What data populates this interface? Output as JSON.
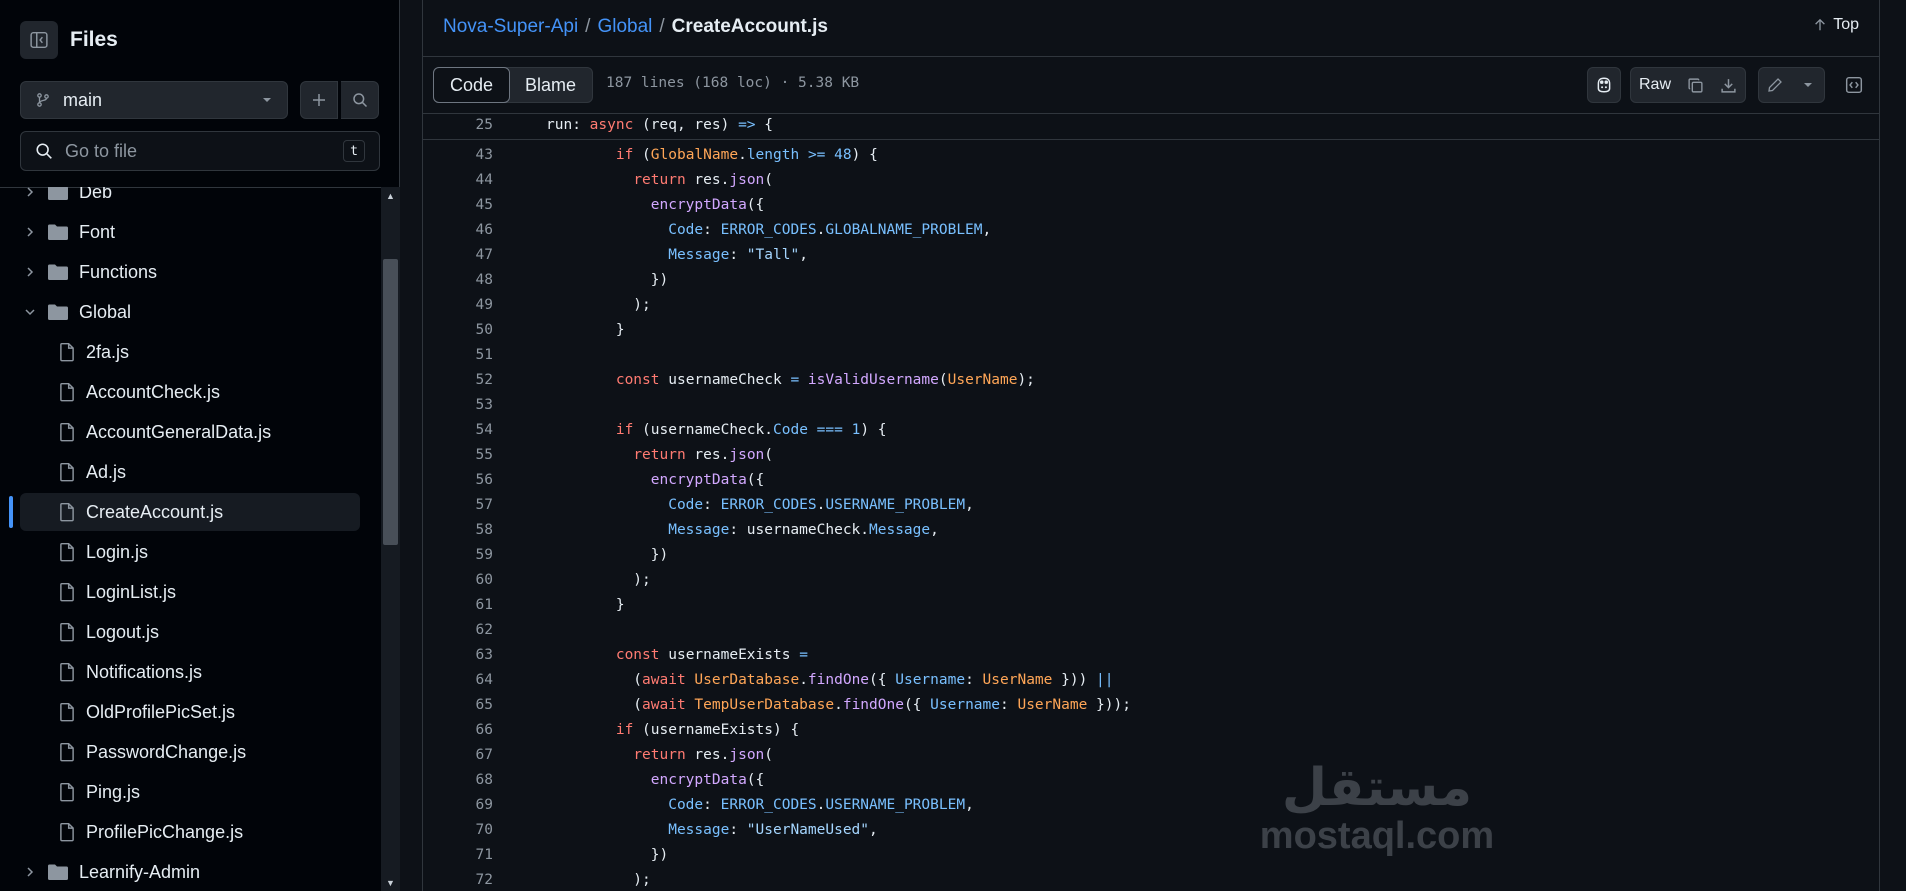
{
  "sidebar": {
    "title": "Files",
    "branch": "main",
    "search_placeholder": "Go to file",
    "search_shortcut": "t",
    "tree": [
      {
        "label": "Deb",
        "type": "folder",
        "expanded": false
      },
      {
        "label": "Font",
        "type": "folder",
        "expanded": false
      },
      {
        "label": "Functions",
        "type": "folder",
        "expanded": false
      },
      {
        "label": "Global",
        "type": "folder",
        "expanded": true
      },
      {
        "label": "2fa.js",
        "type": "file"
      },
      {
        "label": "AccountCheck.js",
        "type": "file"
      },
      {
        "label": "AccountGeneralData.js",
        "type": "file"
      },
      {
        "label": "Ad.js",
        "type": "file"
      },
      {
        "label": "CreateAccount.js",
        "type": "file",
        "selected": true
      },
      {
        "label": "Login.js",
        "type": "file"
      },
      {
        "label": "LoginList.js",
        "type": "file"
      },
      {
        "label": "Logout.js",
        "type": "file"
      },
      {
        "label": "Notifications.js",
        "type": "file"
      },
      {
        "label": "OldProfilePicSet.js",
        "type": "file"
      },
      {
        "label": "PasswordChange.js",
        "type": "file"
      },
      {
        "label": "Ping.js",
        "type": "file"
      },
      {
        "label": "ProfilePicChange.js",
        "type": "file"
      },
      {
        "label": "Learnify-Admin",
        "type": "folder",
        "expanded": false
      }
    ]
  },
  "header": {
    "breadcrumb": {
      "repo": "Nova-Super-Api",
      "folder": "Global",
      "file": "CreateAccount.js"
    },
    "top_label": "Top"
  },
  "toolbar": {
    "code_tab": "Code",
    "blame_tab": "Blame",
    "meta": "187 lines (168 loc) · 5.38 KB",
    "raw_label": "Raw"
  },
  "sticky_line": {
    "num": "25",
    "tokens": [
      [
        "",
        "run: "
      ],
      [
        "kw",
        "async"
      ],
      [
        "",
        " (req, res) "
      ],
      [
        "op",
        "=>"
      ],
      [
        "",
        " {"
      ]
    ]
  },
  "code_lines": [
    {
      "num": "43",
      "tokens": [
        [
          "",
          "        "
        ],
        [
          "kw",
          "if"
        ],
        [
          "",
          " ("
        ],
        [
          "va",
          "GlobalName"
        ],
        [
          "",
          "."
        ],
        [
          "pr",
          "length"
        ],
        [
          "",
          " "
        ],
        [
          "op",
          ">="
        ],
        [
          "",
          " "
        ],
        [
          "pr",
          "48"
        ],
        [
          "",
          ") {"
        ]
      ]
    },
    {
      "num": "44",
      "tokens": [
        [
          "",
          "          "
        ],
        [
          "kw",
          "return"
        ],
        [
          "",
          " res."
        ],
        [
          "fn",
          "json"
        ],
        [
          "",
          "("
        ]
      ]
    },
    {
      "num": "45",
      "tokens": [
        [
          "",
          "            "
        ],
        [
          "fn",
          "encryptData"
        ],
        [
          "",
          "({"
        ]
      ]
    },
    {
      "num": "46",
      "tokens": [
        [
          "",
          "              "
        ],
        [
          "pr",
          "Code"
        ],
        [
          "",
          ": "
        ],
        [
          "pr",
          "ERROR_CODES"
        ],
        [
          "",
          "."
        ],
        [
          "pr",
          "GLOBALNAME_PROBLEM"
        ],
        [
          "",
          ","
        ]
      ]
    },
    {
      "num": "47",
      "tokens": [
        [
          "",
          "              "
        ],
        [
          "pr",
          "Message"
        ],
        [
          "",
          ": "
        ],
        [
          "st",
          "\"Tall\""
        ],
        [
          "",
          ","
        ]
      ]
    },
    {
      "num": "48",
      "tokens": [
        [
          "",
          "            })"
        ]
      ]
    },
    {
      "num": "49",
      "tokens": [
        [
          "",
          "          );"
        ]
      ]
    },
    {
      "num": "50",
      "tokens": [
        [
          "",
          "        }"
        ]
      ]
    },
    {
      "num": "51",
      "tokens": [
        [
          "",
          ""
        ]
      ]
    },
    {
      "num": "52",
      "tokens": [
        [
          "",
          "        "
        ],
        [
          "kw",
          "const"
        ],
        [
          "",
          " usernameCheck "
        ],
        [
          "op",
          "="
        ],
        [
          "",
          " "
        ],
        [
          "fn",
          "isValidUsername"
        ],
        [
          "",
          "("
        ],
        [
          "va",
          "UserName"
        ],
        [
          "",
          ");"
        ]
      ]
    },
    {
      "num": "53",
      "tokens": [
        [
          "",
          ""
        ]
      ]
    },
    {
      "num": "54",
      "tokens": [
        [
          "",
          "        "
        ],
        [
          "kw",
          "if"
        ],
        [
          "",
          " (usernameCheck."
        ],
        [
          "pr",
          "Code"
        ],
        [
          "",
          " "
        ],
        [
          "op",
          "==="
        ],
        [
          "",
          " "
        ],
        [
          "pr",
          "1"
        ],
        [
          "",
          ") {"
        ]
      ]
    },
    {
      "num": "55",
      "tokens": [
        [
          "",
          "          "
        ],
        [
          "kw",
          "return"
        ],
        [
          "",
          " res."
        ],
        [
          "fn",
          "json"
        ],
        [
          "",
          "("
        ]
      ]
    },
    {
      "num": "56",
      "tokens": [
        [
          "",
          "            "
        ],
        [
          "fn",
          "encryptData"
        ],
        [
          "",
          "({"
        ]
      ]
    },
    {
      "num": "57",
      "tokens": [
        [
          "",
          "              "
        ],
        [
          "pr",
          "Code"
        ],
        [
          "",
          ": "
        ],
        [
          "pr",
          "ERROR_CODES"
        ],
        [
          "",
          "."
        ],
        [
          "pr",
          "USERNAME_PROBLEM"
        ],
        [
          "",
          ","
        ]
      ]
    },
    {
      "num": "58",
      "tokens": [
        [
          "",
          "              "
        ],
        [
          "pr",
          "Message"
        ],
        [
          "",
          ": usernameCheck."
        ],
        [
          "pr",
          "Message"
        ],
        [
          "",
          ","
        ]
      ]
    },
    {
      "num": "59",
      "tokens": [
        [
          "",
          "            })"
        ]
      ]
    },
    {
      "num": "60",
      "tokens": [
        [
          "",
          "          );"
        ]
      ]
    },
    {
      "num": "61",
      "tokens": [
        [
          "",
          "        }"
        ]
      ]
    },
    {
      "num": "62",
      "tokens": [
        [
          "",
          ""
        ]
      ]
    },
    {
      "num": "63",
      "tokens": [
        [
          "",
          "        "
        ],
        [
          "kw",
          "const"
        ],
        [
          "",
          " usernameExists "
        ],
        [
          "op",
          "="
        ]
      ]
    },
    {
      "num": "64",
      "tokens": [
        [
          "",
          "          ("
        ],
        [
          "kw",
          "await"
        ],
        [
          "",
          " "
        ],
        [
          "va",
          "UserDatabase"
        ],
        [
          "",
          "."
        ],
        [
          "fn",
          "findOne"
        ],
        [
          "",
          "({ "
        ],
        [
          "pr",
          "Username"
        ],
        [
          "",
          ": "
        ],
        [
          "va",
          "UserName"
        ],
        [
          "",
          " })) "
        ],
        [
          "op",
          "||"
        ]
      ]
    },
    {
      "num": "65",
      "tokens": [
        [
          "",
          "          ("
        ],
        [
          "kw",
          "await"
        ],
        [
          "",
          " "
        ],
        [
          "va",
          "TempUserDatabase"
        ],
        [
          "",
          "."
        ],
        [
          "fn",
          "findOne"
        ],
        [
          "",
          "({ "
        ],
        [
          "pr",
          "Username"
        ],
        [
          "",
          ": "
        ],
        [
          "va",
          "UserName"
        ],
        [
          "",
          " }));"
        ]
      ]
    },
    {
      "num": "66",
      "tokens": [
        [
          "",
          "        "
        ],
        [
          "kw",
          "if"
        ],
        [
          "",
          " (usernameExists) {"
        ]
      ]
    },
    {
      "num": "67",
      "tokens": [
        [
          "",
          "          "
        ],
        [
          "kw",
          "return"
        ],
        [
          "",
          " res."
        ],
        [
          "fn",
          "json"
        ],
        [
          "",
          "("
        ]
      ]
    },
    {
      "num": "68",
      "tokens": [
        [
          "",
          "            "
        ],
        [
          "fn",
          "encryptData"
        ],
        [
          "",
          "({"
        ]
      ]
    },
    {
      "num": "69",
      "tokens": [
        [
          "",
          "              "
        ],
        [
          "pr",
          "Code"
        ],
        [
          "",
          ": "
        ],
        [
          "pr",
          "ERROR_CODES"
        ],
        [
          "",
          "."
        ],
        [
          "pr",
          "USERNAME_PROBLEM"
        ],
        [
          "",
          ","
        ]
      ]
    },
    {
      "num": "70",
      "tokens": [
        [
          "",
          "              "
        ],
        [
          "pr",
          "Message"
        ],
        [
          "",
          ": "
        ],
        [
          "st",
          "\"UserNameUsed\""
        ],
        [
          "",
          ","
        ]
      ]
    },
    {
      "num": "71",
      "tokens": [
        [
          "",
          "            })"
        ]
      ]
    },
    {
      "num": "72",
      "tokens": [
        [
          "",
          "          );"
        ]
      ]
    }
  ],
  "watermark": {
    "arabic": "مستقل",
    "latin": "mostaql.com"
  }
}
